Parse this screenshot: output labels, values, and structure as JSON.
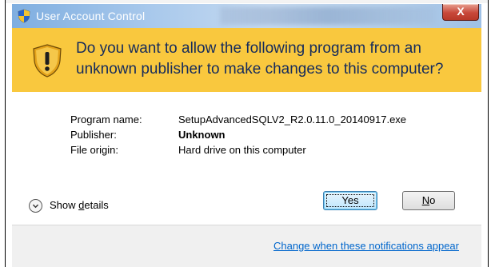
{
  "window": {
    "title": "User Account Control",
    "close_label": "X"
  },
  "banner": {
    "question": "Do you want to allow the following program from an unknown publisher to make changes to this computer?"
  },
  "details": {
    "rows": [
      {
        "label": "Program name:",
        "value": "SetupAdvancedSQLV2_R2.0.11.0_20140917.exe"
      },
      {
        "label": "Publisher:",
        "value": "Unknown"
      },
      {
        "label": "File origin:",
        "value": "Hard drive on this computer"
      }
    ]
  },
  "show_details": {
    "prefix": "Show ",
    "accel": "d",
    "suffix": "etails"
  },
  "buttons": {
    "yes": "Yes",
    "no_accel": "N",
    "no_rest": "o"
  },
  "footer": {
    "link": "Change when these notifications appear"
  },
  "colors": {
    "banner": "#f9c83e",
    "banner_text": "#152b5c",
    "link": "#0066cc"
  }
}
